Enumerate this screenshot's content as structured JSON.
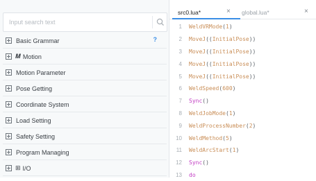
{
  "search": {
    "placeholder": "Input search text"
  },
  "sidebar": {
    "items": [
      {
        "label": "Basic Grammar",
        "help": "?"
      },
      {
        "label": "Motion",
        "glyph": "𝑴"
      },
      {
        "label": "Motion Parameter"
      },
      {
        "label": "Pose Getting"
      },
      {
        "label": "Coordinate System"
      },
      {
        "label": "Load Setting"
      },
      {
        "label": "Safety Setting"
      },
      {
        "label": "Program Managing"
      },
      {
        "label": "I/O",
        "glyph": "⊞"
      }
    ]
  },
  "editor": {
    "tabs": [
      {
        "label": "src0.lua*",
        "active": true,
        "close": "×"
      },
      {
        "label": "global.lua*",
        "active": false,
        "close": "×"
      }
    ],
    "lines": [
      {
        "num": "1",
        "tokens": [
          [
            "fn",
            "WeldVRMode"
          ],
          [
            "punc",
            "("
          ],
          [
            "num",
            "1"
          ],
          [
            "punc",
            ")"
          ]
        ]
      },
      {
        "num": "2",
        "tokens": [
          [
            "fn",
            "MoveJ"
          ],
          [
            "punc",
            "(("
          ],
          [
            "id",
            "InitialPose"
          ],
          [
            "punc",
            "))"
          ]
        ]
      },
      {
        "num": "3",
        "tokens": [
          [
            "fn",
            "MoveJ"
          ],
          [
            "punc",
            "(("
          ],
          [
            "id",
            "InitialPose"
          ],
          [
            "punc",
            "))"
          ]
        ]
      },
      {
        "num": "4",
        "tokens": [
          [
            "fn",
            "MoveJ"
          ],
          [
            "punc",
            "(("
          ],
          [
            "id",
            "InitialPose"
          ],
          [
            "punc",
            "))"
          ]
        ]
      },
      {
        "num": "5",
        "tokens": [
          [
            "fn",
            "MoveJ"
          ],
          [
            "punc",
            "(("
          ],
          [
            "id",
            "InitialPose"
          ],
          [
            "punc",
            "))"
          ]
        ]
      },
      {
        "num": "6",
        "tokens": [
          [
            "fn",
            "WeldSpeed"
          ],
          [
            "punc",
            "("
          ],
          [
            "num",
            "600"
          ],
          [
            "punc",
            ")"
          ]
        ]
      },
      {
        "num": "7",
        "tokens": [
          [
            "kw",
            "Sync"
          ],
          [
            "punc",
            "()"
          ]
        ]
      },
      {
        "num": "8",
        "tokens": [
          [
            "fn",
            "WeldJobMode"
          ],
          [
            "punc",
            "("
          ],
          [
            "num",
            "1"
          ],
          [
            "punc",
            ")"
          ]
        ]
      },
      {
        "num": "9",
        "tokens": [
          [
            "fn",
            "WeldProcessNumber"
          ],
          [
            "punc",
            "("
          ],
          [
            "num",
            "2"
          ],
          [
            "punc",
            ")"
          ]
        ]
      },
      {
        "num": "10",
        "tokens": [
          [
            "fn",
            "WeldMethod"
          ],
          [
            "punc",
            "("
          ],
          [
            "num",
            "5"
          ],
          [
            "punc",
            ")"
          ]
        ]
      },
      {
        "num": "11",
        "tokens": [
          [
            "fn",
            "WeldArcStart"
          ],
          [
            "punc",
            "("
          ],
          [
            "num",
            "1"
          ],
          [
            "punc",
            ")"
          ]
        ]
      },
      {
        "num": "12",
        "tokens": [
          [
            "kw",
            "Sync"
          ],
          [
            "punc",
            "()"
          ]
        ]
      },
      {
        "num": "13",
        "tokens": [
          [
            "kw",
            "do"
          ]
        ]
      }
    ]
  },
  "colors": {
    "accent": "#3a8ee6",
    "function": "#c98e57",
    "keyword": "#c23cc3"
  }
}
